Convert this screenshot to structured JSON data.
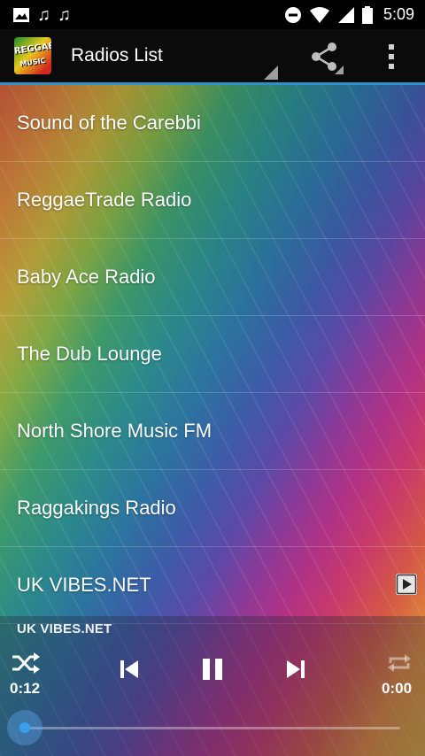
{
  "status_bar": {
    "time": "5:09",
    "left_icons": [
      "image-icon",
      "music-note-icon",
      "music-note-icon"
    ],
    "right_icons": [
      "do-not-disturb-icon",
      "wifi-icon",
      "signal-icon",
      "battery-icon"
    ]
  },
  "action_bar": {
    "logo_text": "REGGAE",
    "logo_subtext": "MUSIC",
    "title": "Radios List",
    "share_icon": "share-icon",
    "overflow_icon": "more-vert-icon",
    "accent_color": "#2f8fc9"
  },
  "stations": [
    {
      "name": "Sound of the Carebbi"
    },
    {
      "name": "ReggaeTrade Radio"
    },
    {
      "name": "Baby Ace Radio"
    },
    {
      "name": "The Dub Lounge"
    },
    {
      "name": "North Shore Music FM"
    },
    {
      "name": "Raggakings Radio"
    },
    {
      "name": "UK VIBES.NET",
      "playing": true
    }
  ],
  "player": {
    "now_playing": "UK VIBES.NET",
    "elapsed": "0:12",
    "duration": "0:00",
    "progress": 0.0,
    "controls": [
      "shuffle-icon",
      "previous-icon",
      "pause-icon",
      "next-icon",
      "repeat-icon"
    ],
    "seek_color": "#3aa0ee"
  }
}
